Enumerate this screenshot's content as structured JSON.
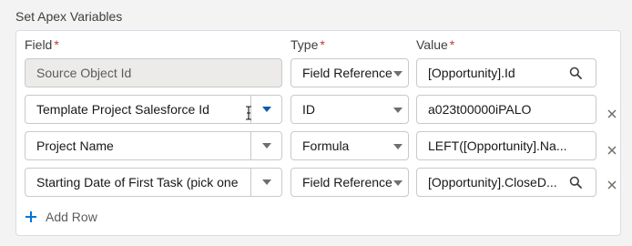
{
  "section": {
    "title": "Set Apex Variables"
  },
  "headers": {
    "field": "Field",
    "type": "Type",
    "value": "Value",
    "required_marker": "*"
  },
  "rows": [
    {
      "field": "Source Object Id",
      "field_disabled": true,
      "type": "Field Reference",
      "value": "[Opportunity].Id",
      "value_has_search": true,
      "removable": false
    },
    {
      "field": "Template Project Salesforce Id",
      "field_disabled": false,
      "type": "ID",
      "value": "a023t00000iPALO",
      "value_has_search": false,
      "removable": true
    },
    {
      "field": "Project Name",
      "field_disabled": false,
      "type": "Formula",
      "value": "LEFT([Opportunity].Na...",
      "value_has_search": false,
      "removable": true
    },
    {
      "field": "Starting Date of First Task (pick one",
      "field_disabled": false,
      "type": "Field Reference",
      "value": "[Opportunity].CloseD...",
      "value_has_search": true,
      "removable": true
    }
  ],
  "add_row": {
    "label": "Add Row"
  },
  "icons": {
    "search": "search-icon",
    "close": "close-icon",
    "add": "plus-icon",
    "dropdown": "chevron-down-icon",
    "cursor": "text-cursor-icon"
  },
  "colors": {
    "required": "#c23934",
    "active_chevron": "#0b5cab",
    "add_icon": "#0176d3",
    "disabled_bg": "#ecebea"
  }
}
